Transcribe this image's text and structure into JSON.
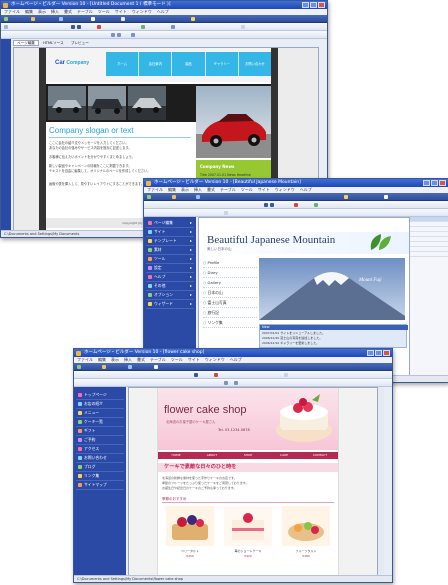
{
  "window1": {
    "title": "ホームページ・ビルダー Version 10 - [Untitled Document 1 ( 標準モード )]",
    "menu": [
      "ファイル",
      "編集",
      "表示",
      "挿入",
      "書式",
      "テーブル",
      "ツール",
      "サイト",
      "ウィンドウ",
      "ヘルプ"
    ],
    "editor_tabs": [
      "ページ編集",
      "HTMLソース",
      "プレビュー"
    ],
    "site": {
      "logo_bold": "Car",
      "logo_rest": " Company",
      "nav": [
        "ホーム",
        "会社案内",
        "製品",
        "ギャラリー",
        "お問い合わせ"
      ],
      "slogan": "Company slogan or text",
      "body_lines": [
        "ここに会社の紹介文やメッセージを入力してください。",
        "あなたの会社の強みやサービス内容を簡潔に記述します。",
        "お客様に伝えたいポイントを分かりやすくまとめましょう。",
        "新しい製品やキャンペーンの情報をここに掲載できます。",
        "テキストを自由に編集して、オリジナルのページを作成してください。",
        "画像や表を挿入して、見やすいレイアウトにすることができます。"
      ],
      "news_title": "Company News",
      "news_item": "Title 2007.01.01 News Headline",
      "footer_text": "Copyright (C) Car Company All Rights Reserved."
    },
    "status": "C:\\Documents and Settings\\My Documents"
  },
  "window2": {
    "title": "ホームページ・ビルダー Version 10 - [Beautiful Japanese Mountain]",
    "menu": [
      "ファイル",
      "編集",
      "表示",
      "挿入",
      "書式",
      "テーブル",
      "ツール",
      "サイト",
      "ウィンドウ",
      "ヘルプ"
    ],
    "site": {
      "title": "Beautiful Japanese Mountain",
      "subtitle": "美しい日本の山",
      "nav": [
        "Profile",
        "Diary",
        "Gallery",
        "日本の山",
        "富士山写真",
        "旅行記",
        "リンク集"
      ],
      "photo_caption": "Mount Fuji",
      "news_title": "New",
      "news_lines": [
        "2007/01/01 サイトをリニューアルしました。",
        "2006/12/20 富士山の写真を追加しました。",
        "2006/12/10 ギャラリーを更新しました。"
      ]
    },
    "sidebar_items": [
      "ページ編集",
      "サイト",
      "テンプレート",
      "素材",
      "ツール",
      "設定",
      "ヘルプ",
      "その他",
      "オプション",
      "ウィザード"
    ],
    "status": "C:\\Documents and Settings\\My Documents"
  },
  "window3": {
    "title": "ホームページ・ビルダー Version 10 - [flower cake shop]",
    "menu": [
      "ファイル",
      "編集",
      "表示",
      "挿入",
      "書式",
      "テーブル",
      "ツール",
      "サイト",
      "ウィンドウ",
      "ヘルプ"
    ],
    "sidebar_items": [
      "トップページ",
      "お店の紹介",
      "メニュー",
      "ケーキ一覧",
      "ギフト",
      "ご予約",
      "アクセス",
      "お問い合わせ",
      "ブログ",
      "リンク集",
      "サイトマップ"
    ],
    "site": {
      "title": "flower cake shop",
      "subtitle": "北海道のお菓子屋のケーキ屋さん",
      "phone": "Tel. 03-1234-5678",
      "nav": [
        "HOME",
        "ABOUT",
        "SHOP",
        "CAKE",
        "CONTACT"
      ],
      "heading": "ケーキで素敵な日々のひと時を",
      "intro_lines": [
        "北海道の新鮮な素材を使った手作りケーキのお店です。",
        "季節のフルーツをたっぷり使ったケーキをご用意しております。",
        "お誕生日や記念日のケーキのご予約も承っております。"
      ],
      "section": "季節のおすすめ",
      "items": [
        {
          "name": "ベリータルト",
          "price": "¥450"
        },
        {
          "name": "苺のショートケーキ",
          "price": "¥420"
        },
        {
          "name": "フルーツタルト",
          "price": "¥480"
        }
      ]
    },
    "status": "C:\\Documents and Settings\\My Documents\\flower cake shop"
  }
}
